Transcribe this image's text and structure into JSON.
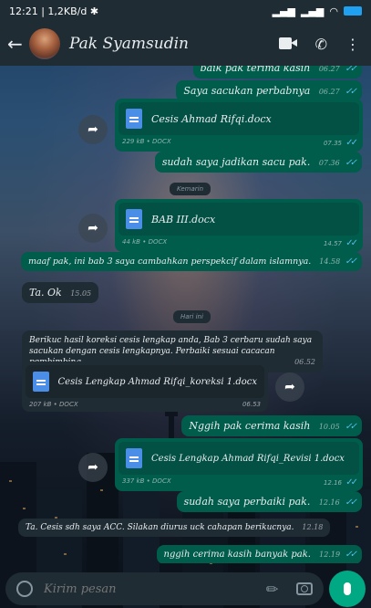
{
  "status_bar": {
    "time": "12:21",
    "speed": "1,2KB/d"
  },
  "header": {
    "back_glyph": "←",
    "contact_name": "Pak Syamsudin",
    "icons": [
      "video-call-icon",
      "phone-icon",
      "more-options-icon"
    ]
  },
  "messages": {
    "m0": {
      "text": "baik pak terima kasih",
      "time": "06.27"
    },
    "m1": {
      "text": "Saya sacukan perbabnya",
      "time": "06.27"
    },
    "doc1": {
      "name": "Cesis Ahmad Rifqi.docx",
      "size": "229 kB",
      "type": "DOCX",
      "time": "07.35"
    },
    "m2": {
      "text": "sudah saya jadikan sacu pak.",
      "time": "07.36"
    },
    "date1": "Kemarin",
    "doc2": {
      "name": "BAB III.docx",
      "size": "44 kB",
      "type": "DOCX",
      "time": "14.57"
    },
    "m3": {
      "text": "maaf pak, ini bab 3 saya cambahkan perspekcif dalam islamnya.",
      "time": "14.58"
    },
    "m4": {
      "text": "Ta. Ok",
      "time": "15.05"
    },
    "date2": "Hari ini",
    "m5": {
      "text": "Berikuc hasil koreksi cesis lengkap anda, Bab 3 cerbaru sudah saya sacukan dengan cesis lengkapnya. Perbaiki sesuai cacacan pembimbing",
      "time": "06.52"
    },
    "doc3": {
      "name": "Cesis Lengkap Ahmad Rifqi_koreksi 1.docx",
      "size": "207 kB",
      "type": "DOCX",
      "time": "06.53"
    },
    "m6": {
      "text": "Nggih pak cerima kasih",
      "time": "10.05"
    },
    "doc4": {
      "name": "Cesis Lengkap Ahmad Rifqi_Revisi 1.docx",
      "size": "337 kB",
      "type": "DOCX",
      "time": "12.16"
    },
    "m7": {
      "text": "sudah saya perbaiki pak.",
      "time": "12.16"
    },
    "m8": {
      "text": "Ta. Cesis sdh saya ACC. Silakan diurus uck cahapan berikucnya.",
      "time": "12.18"
    },
    "m9": {
      "text": "nggih cerima kasih banyak pak.",
      "time": "12.19"
    }
  },
  "input": {
    "placeholder": "Kirim pesan"
  },
  "colors": {
    "outgoing": "#005c4b",
    "incoming": "#1f2c34",
    "accent": "#00a884",
    "read_ticks": "#53bdeb"
  }
}
